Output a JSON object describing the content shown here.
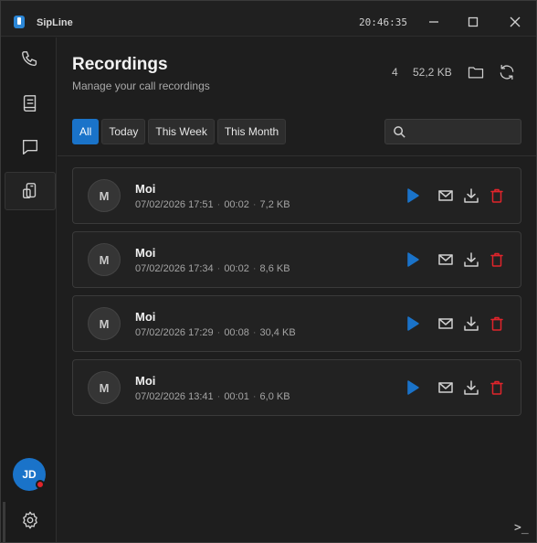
{
  "window": {
    "title": "SipLine",
    "clock": "20:46:35"
  },
  "sidebar": {
    "items": [
      {
        "name": "calls",
        "icon": "phone-icon"
      },
      {
        "name": "contacts",
        "icon": "contacts-book-icon"
      },
      {
        "name": "messages",
        "icon": "chat-icon"
      },
      {
        "name": "recordings",
        "icon": "voicemail-device-icon",
        "active": true
      }
    ],
    "user_initials": "JD",
    "user_status_color": "#e0242b",
    "settings_icon": "gear-icon"
  },
  "header": {
    "title": "Recordings",
    "subtitle": "Manage your call recordings",
    "count": "4",
    "total_size": "52,2 KB"
  },
  "filters": [
    {
      "label": "All",
      "active": true
    },
    {
      "label": "Today",
      "active": false
    },
    {
      "label": "This Week",
      "active": false
    },
    {
      "label": "This Month",
      "active": false
    }
  ],
  "search": {
    "placeholder": "",
    "value": ""
  },
  "recordings": [
    {
      "initial": "M",
      "name": "Moi",
      "datetime": "07/02/2026 17:51",
      "duration": "00:02",
      "size": "7,2 KB"
    },
    {
      "initial": "M",
      "name": "Moi",
      "datetime": "07/02/2026 17:34",
      "duration": "00:02",
      "size": "8,6 KB"
    },
    {
      "initial": "M",
      "name": "Moi",
      "datetime": "07/02/2026 17:29",
      "duration": "00:08",
      "size": "30,4 KB"
    },
    {
      "initial": "M",
      "name": "Moi",
      "datetime": "07/02/2026 13:41",
      "duration": "00:01",
      "size": "6,0 KB"
    }
  ],
  "colors": {
    "accent": "#1a73c9",
    "delete": "#e0242b",
    "play": "#1a73c9"
  },
  "terminal_glyph": ">_"
}
